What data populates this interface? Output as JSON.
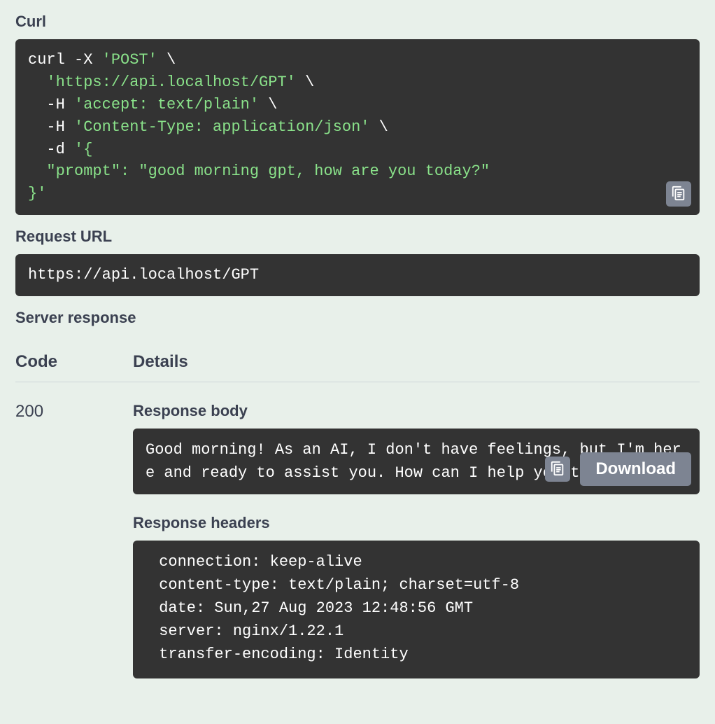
{
  "labels": {
    "curl": "Curl",
    "request_url": "Request URL",
    "server_response": "Server response",
    "code": "Code",
    "details": "Details",
    "response_body": "Response body",
    "response_headers": "Response headers",
    "download": "Download"
  },
  "curl": {
    "cmd": "curl -X ",
    "method": "'POST'",
    "cont": " \\",
    "url": "'https://api.localhost/GPT'",
    "h1": "'accept: text/plain'",
    "h2": "'Content-Type: application/json'",
    "body_open": "'{",
    "body_line": "  \"prompt\": \"good morning gpt, how are you today?\"",
    "body_close": "}'"
  },
  "request_url": "https://api.localhost/GPT",
  "response": {
    "status_code": "200",
    "body_seg1": "Good morning! As an AI, I don",
    "body_seg2": "'t have feelings, but I'",
    "body_seg3": "m here and ready to assist you. How can I h",
    "body_seg4": "elp",
    "body_seg5": " you today?",
    "headers": " connection: keep-alive \n content-type: text/plain; charset=utf-8 \n date: Sun,27 Aug 2023 12:48:56 GMT \n server: nginx/1.22.1 \n transfer-encoding: Identity "
  }
}
